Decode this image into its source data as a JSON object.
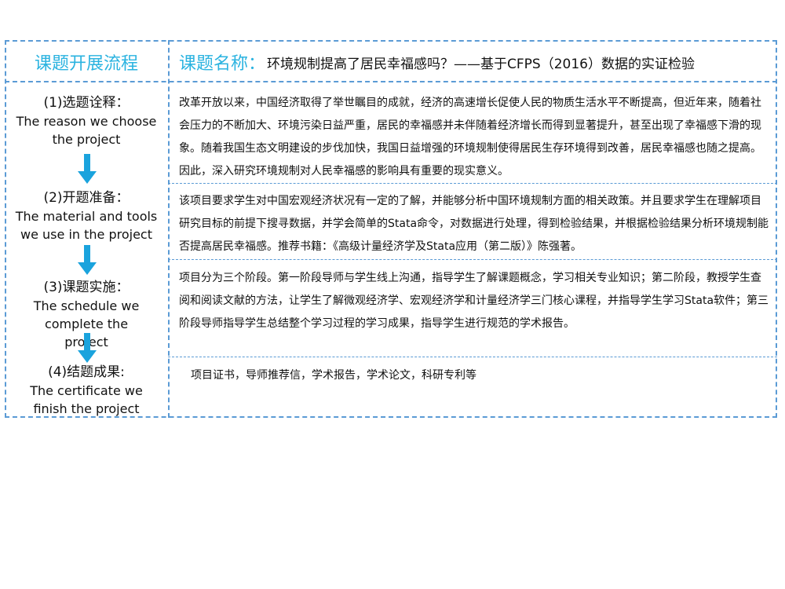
{
  "header": {
    "left_label": "课题开展流程",
    "title_label": "课题名称：",
    "title_text": "环境规制提高了居民幸福感吗？——基于CFPS（2016）数据的实证检验"
  },
  "steps": [
    {
      "cn": "(1)选题诠释：",
      "en": "The reason we choose the project"
    },
    {
      "cn": "(2)开题准备：",
      "en": "The material and tools we use in the project"
    },
    {
      "cn": "(3)课题实施：",
      "en": "The schedule we complete the project"
    },
    {
      "cn": "(4)结题成果:",
      "en": "The certificate we finish the project"
    }
  ],
  "details": [
    "改革开放以来，中国经济取得了举世瞩目的成就，经济的高速增长促使人民的物质生活水平不断提高，但近年来，随着社会压力的不断加大、环境污染日益严重，居民的幸福感并未伴随着经济增长而得到显著提升，甚至出现了幸福感下滑的现象。随着我国生态文明建设的步伐加快，我国日益增强的环境规制使得居民生存环境得到改善，居民幸福感也随之提高。因此，深入研究环境规制对人民幸福感的影响具有重要的现实意义。",
    "该项目要求学生对中国宏观经济状况有一定的了解，并能够分析中国环境规制方面的相关政策。并且要求学生在理解项目研究目标的前提下搜寻数据，并学会简单的Stata命令，对数据进行处理，得到检验结果，并根据检验结果分析环境规制能否提高居民幸福感。推荐书籍：《高级计量经济学及Stata应用（第二版）》陈强著。",
    "项目分为三个阶段。第一阶段导师与学生线上沟通，指导学生了解课题概念，学习相关专业知识；第二阶段，教授学生查阅和阅读文献的方法，让学生了解微观经济学、宏观经济学和计量经济学三门核心课程，并指导学生学习Stata软件；第三阶段导师指导学生总结整个学习过程的学习成果，指导学生进行规范的学术报告。",
    "项目证书，导师推荐信，学术报告，学术论文，科研专利等"
  ],
  "colors": {
    "accent": "#2bb3e0",
    "border": "#5b9bd5",
    "arrow": "#1aa3dd"
  }
}
